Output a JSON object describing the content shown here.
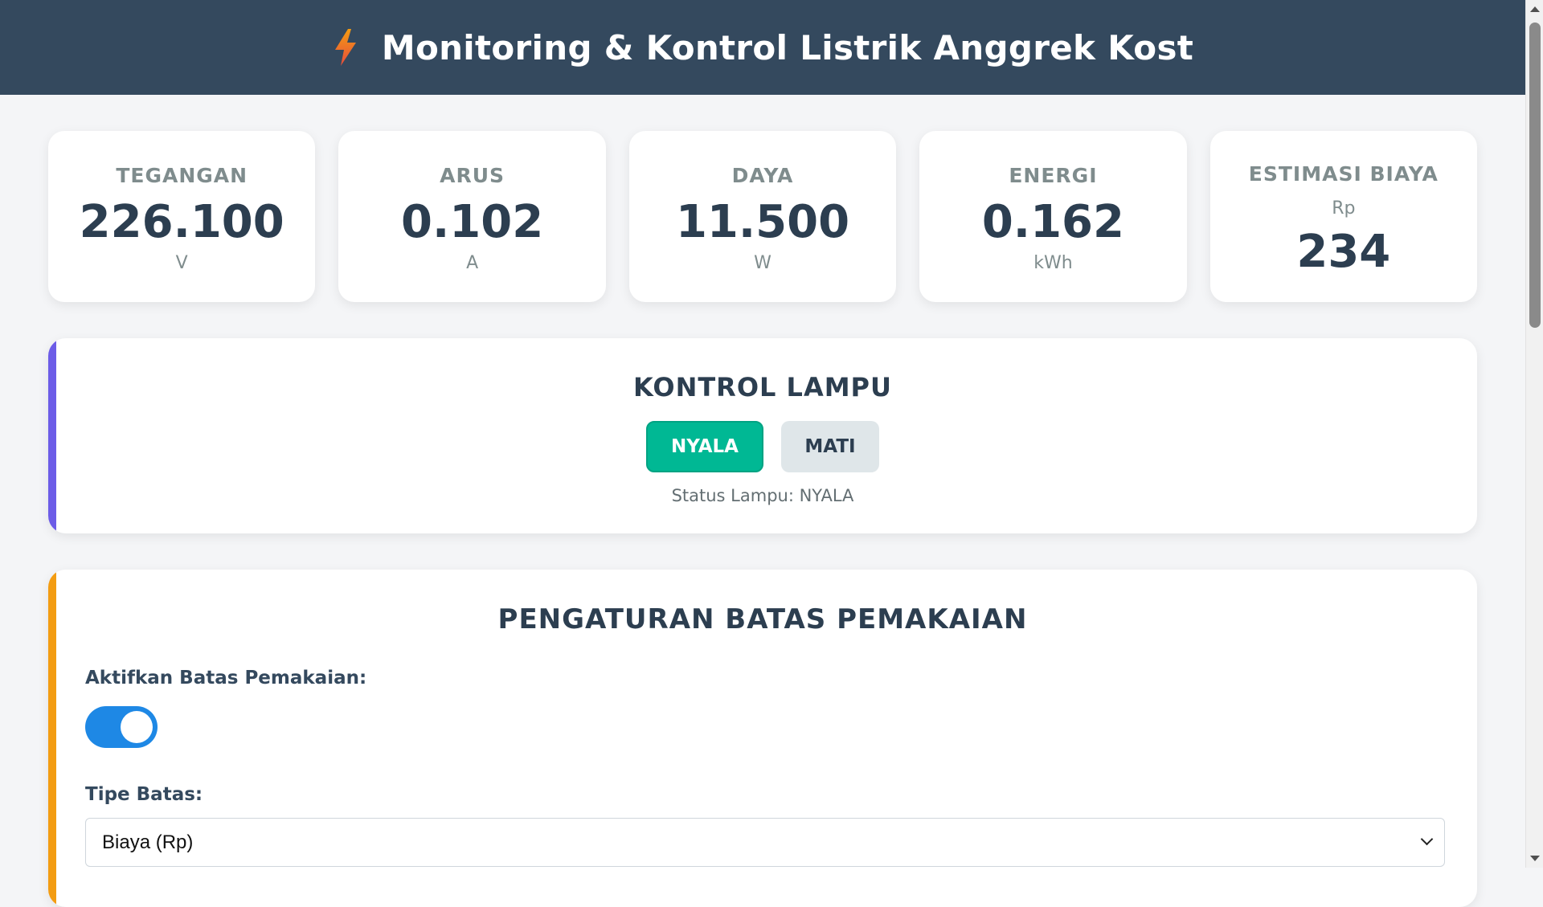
{
  "header": {
    "icon": "lightning-bolt-icon",
    "title": "Monitoring & Kontrol Listrik Anggrek Kost",
    "colors": {
      "background": "#34495e",
      "icon_top": "#f39c12",
      "icon_bottom": "#e74c3c"
    }
  },
  "stats": [
    {
      "label": "TEGANGAN",
      "value": "226.100",
      "unit": "V"
    },
    {
      "label": "ARUS",
      "value": "0.102",
      "unit": "A"
    },
    {
      "label": "DAYA",
      "value": "11.500",
      "unit": "W"
    },
    {
      "label": "ENERGI",
      "value": "0.162",
      "unit": "kWh"
    }
  ],
  "cost": {
    "label": "ESTIMASI BIAYA",
    "prefix": "Rp",
    "value": "234"
  },
  "lamp_control": {
    "title": "KONTROL LAMPU",
    "on_label": "NYALA",
    "off_label": "MATI",
    "status_text": "Status Lampu: NYALA",
    "colors": {
      "accent": "#6c5ce7",
      "on": "#00b894",
      "off": "#dfe6e9"
    }
  },
  "limit_settings": {
    "title": "PENGATURAN BATAS PEMAKAIAN",
    "enable_label": "Aktifkan Batas Pemakaian:",
    "enabled": true,
    "type_label": "Tipe Batas:",
    "type_selected": "Biaya (Rp)",
    "colors": {
      "accent": "#f39c12",
      "toggle": "#1e88e5"
    }
  }
}
